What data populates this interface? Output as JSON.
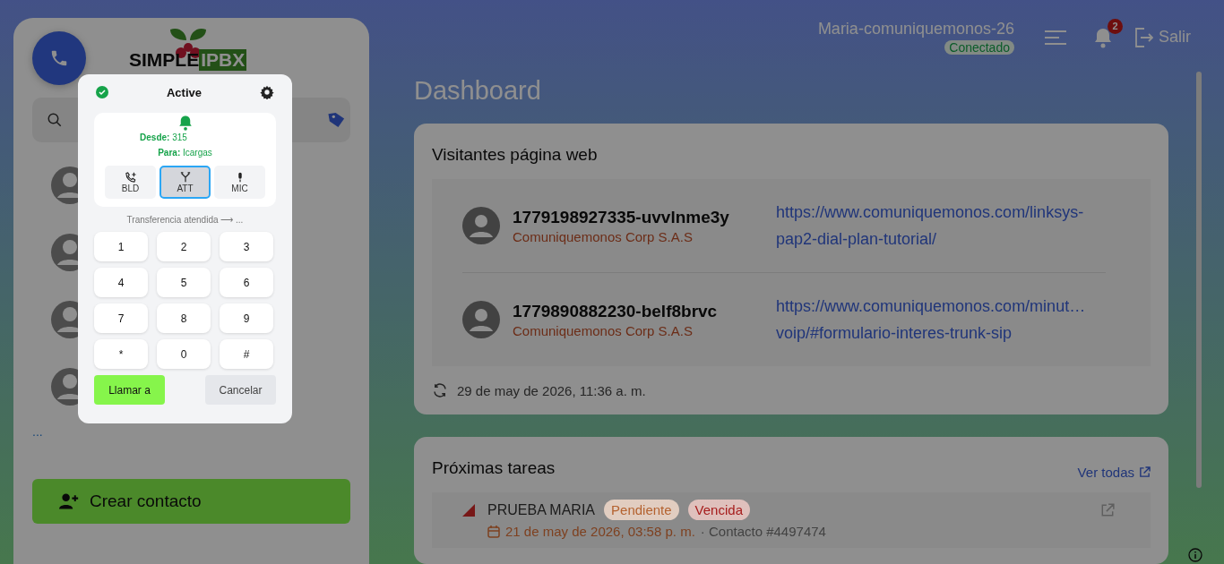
{
  "header": {
    "user": "Maria-comuniquemonos-26",
    "status": "Conectado",
    "notifications": "2",
    "logout": "Salir"
  },
  "sidebar": {
    "logo": [
      "SIMPLE",
      "IPBX"
    ],
    "more": "...",
    "create_button": "Crear contacto"
  },
  "page_title": "Dashboard",
  "visitors": {
    "title": "Visitantes página web",
    "rows": [
      {
        "id": "1779198927335-uvvlnme3y",
        "company": "Comuniquemonos Corp S.A.S",
        "url_lines": [
          "https://www.comuniquemonos.com/linksys-",
          "pap2-dial-plan-tutorial/"
        ]
      },
      {
        "id": "1779890882230-belf8brvc",
        "company": "Comuniquemonos Corp S.A.S",
        "url_lines": [
          "https://www.comuniquemonos.com/minut…",
          "voip/#formulario-interes-trunk-sip"
        ]
      }
    ],
    "updated": "29 de may de 2026, 11:36 a. m."
  },
  "tasks": {
    "title": "Próximas tareas",
    "link": "Ver todas",
    "rows": [
      {
        "name": "PRUEBA MARIA",
        "tags": [
          {
            "label": "Pendiente",
            "color": "#b4622f"
          },
          {
            "label": "Vencida",
            "color": "#a61c1c"
          }
        ],
        "date": "21 de may de 2026, 03:58 p. m.",
        "contact": "· Contacto #4497474"
      }
    ]
  },
  "dialer": {
    "status": "Active",
    "from": "**Desde:** 315",
    "to": "**Para:** Icargas",
    "actions": [
      {
        "label": "BLD",
        "kind": "transfer",
        "selected": false
      },
      {
        "label": "ATT",
        "kind": "attended",
        "selected": true
      },
      {
        "label": "MIC",
        "kind": "mic",
        "selected": false
      }
    ],
    "hint": "Transferencia atendida ⟶ ...",
    "keys": [
      "1",
      "2",
      "3",
      "4",
      "5",
      "6",
      "7",
      "8",
      "9",
      "*",
      "0",
      "#"
    ],
    "call_button": "Llamar a",
    "cancel_button": "Cancelar"
  }
}
